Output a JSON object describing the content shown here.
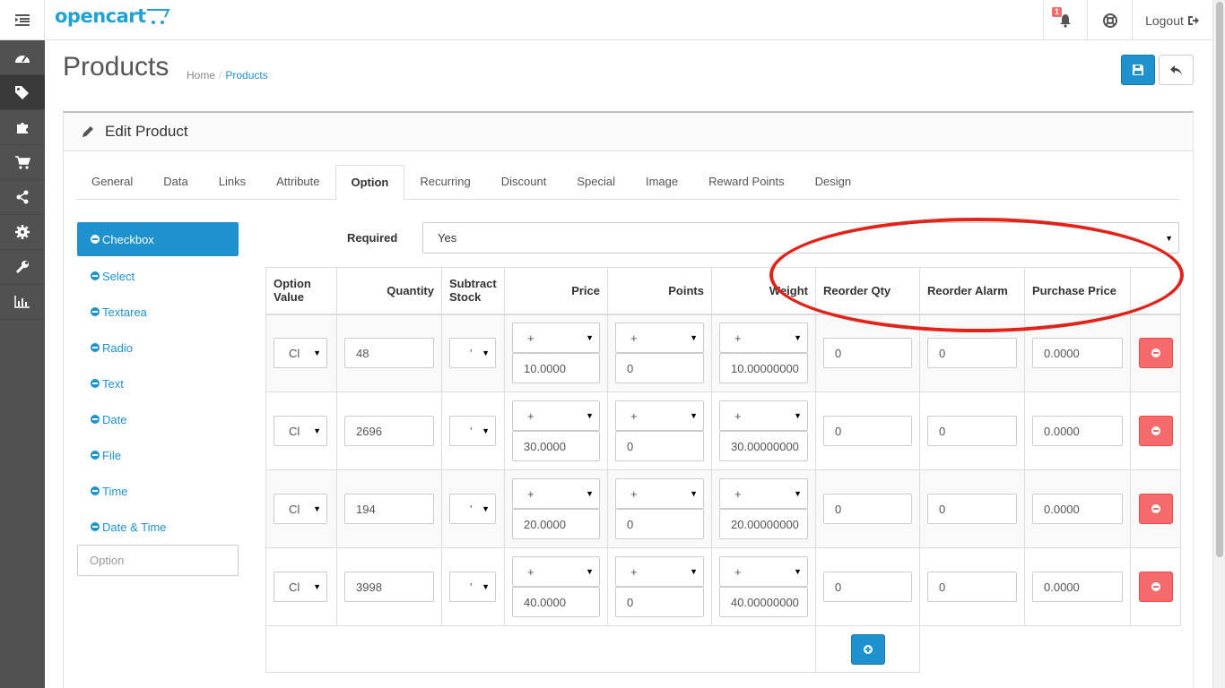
{
  "app": {
    "logo": "opencart",
    "logout_label": "Logout",
    "notification_count": "1"
  },
  "page": {
    "title": "Products",
    "breadcrumb": [
      "Home",
      "Products"
    ]
  },
  "panel": {
    "heading": "Edit Product"
  },
  "tabs": [
    "General",
    "Data",
    "Links",
    "Attribute",
    "Option",
    "Recurring",
    "Discount",
    "Special",
    "Image",
    "Reward Points",
    "Design"
  ],
  "active_tab": "Option",
  "options": [
    "Checkbox",
    "Select",
    "Textarea",
    "Radio",
    "Text",
    "Date",
    "File",
    "Time",
    "Date & Time"
  ],
  "option_input_placeholder": "Option",
  "required": {
    "label": "Required",
    "value": "Yes"
  },
  "table": {
    "headers": {
      "option_value": "Option Value",
      "quantity": "Quantity",
      "subtract": "Subtract Stock",
      "price": "Price",
      "points": "Points",
      "weight": "Weight",
      "reorder_qty": "Reorder Qty",
      "reorder_alarm": "Reorder Alarm",
      "purchase_price": "Purchase Price"
    },
    "rows": [
      {
        "option_value": "Cl",
        "quantity": "48",
        "subtract": "'",
        "price_prefix": "+",
        "price": "10.0000",
        "points_prefix": "+",
        "points": "0",
        "weight_prefix": "+",
        "weight": "10.00000000",
        "reorder_qty": "0",
        "reorder_alarm": "0",
        "purchase_price": "0.0000"
      },
      {
        "option_value": "Cl",
        "quantity": "2696",
        "subtract": "'",
        "price_prefix": "+",
        "price": "30.0000",
        "points_prefix": "+",
        "points": "0",
        "weight_prefix": "+",
        "weight": "30.00000000",
        "reorder_qty": "0",
        "reorder_alarm": "0",
        "purchase_price": "0.0000"
      },
      {
        "option_value": "Cl",
        "quantity": "194",
        "subtract": "'",
        "price_prefix": "+",
        "price": "20.0000",
        "points_prefix": "+",
        "points": "0",
        "weight_prefix": "+",
        "weight": "20.00000000",
        "reorder_qty": "0",
        "reorder_alarm": "0",
        "purchase_price": "0.0000"
      },
      {
        "option_value": "Cl",
        "quantity": "3998",
        "subtract": "'",
        "price_prefix": "+",
        "price": "40.0000",
        "points_prefix": "+",
        "points": "0",
        "weight_prefix": "+",
        "weight": "40.00000000",
        "reorder_qty": "0",
        "reorder_alarm": "0",
        "purchase_price": "0.0000"
      }
    ]
  },
  "colors": {
    "primary": "#1e91cf",
    "danger": "#f56b6b",
    "sidebar": "#515151",
    "annotation": "#e2231a"
  },
  "icons": {
    "sidebar": [
      "dashboard-icon",
      "tags-icon",
      "puzzle-icon",
      "shopping-cart-icon",
      "share-icon",
      "gear-icon",
      "wrench-icon",
      "bar-chart-icon"
    ]
  }
}
